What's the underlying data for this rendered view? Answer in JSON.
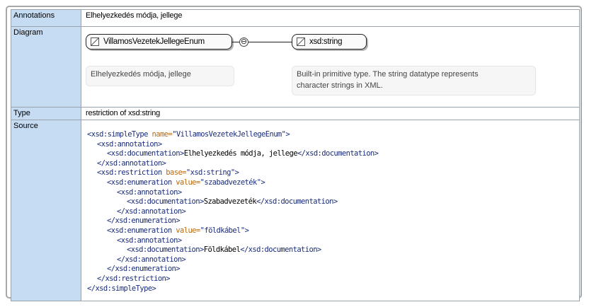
{
  "rows": {
    "annotations": {
      "label": "Annotations",
      "value": "Elhelyezkedés módja, jellege"
    },
    "diagram": {
      "label": "Diagram",
      "node_main": "VillamosVezetekJellegeEnum",
      "connector_symbol": "⊖",
      "node_base": "xsd:string",
      "doc_main": "Elhelyezkedés módja, jellege",
      "doc_base_line1": "Built-in primitive type. The string datatype represents",
      "doc_base_line2": "character strings in XML."
    },
    "type": {
      "label": "Type",
      "value": "restriction of xsd:string"
    },
    "source": {
      "label": "Source"
    }
  },
  "source_lines": [
    {
      "indent": 0,
      "parts": [
        [
          "t",
          "<xsd:simpleType "
        ],
        [
          "an",
          "name="
        ],
        [
          "av",
          "\"VillamosVezetekJellegeEnum\""
        ],
        [
          "t",
          ">"
        ]
      ]
    },
    {
      "indent": 1,
      "parts": [
        [
          "t",
          "<xsd:annotation>"
        ]
      ]
    },
    {
      "indent": 2,
      "parts": [
        [
          "t",
          "<xsd:documentation>"
        ],
        [
          "tx",
          "Elhelyezkedés módja, jellege"
        ],
        [
          "t",
          "</xsd:documentation>"
        ]
      ]
    },
    {
      "indent": 1,
      "parts": [
        [
          "t",
          "</xsd:annotation>"
        ]
      ]
    },
    {
      "indent": 1,
      "parts": [
        [
          "t",
          "<xsd:restriction "
        ],
        [
          "an",
          "base="
        ],
        [
          "av",
          "\"xsd:string\""
        ],
        [
          "t",
          ">"
        ]
      ]
    },
    {
      "indent": 2,
      "parts": [
        [
          "t",
          "<xsd:enumeration "
        ],
        [
          "an",
          "value="
        ],
        [
          "av",
          "\"szabadvezeték\""
        ],
        [
          "t",
          ">"
        ]
      ]
    },
    {
      "indent": 3,
      "parts": [
        [
          "t",
          "<xsd:annotation>"
        ]
      ]
    },
    {
      "indent": 4,
      "parts": [
        [
          "t",
          "<xsd:documentation>"
        ],
        [
          "tx",
          "Szabadvezeték"
        ],
        [
          "t",
          "</xsd:documentation>"
        ]
      ]
    },
    {
      "indent": 3,
      "parts": [
        [
          "t",
          "</xsd:annotation>"
        ]
      ]
    },
    {
      "indent": 2,
      "parts": [
        [
          "t",
          "</xsd:enumeration>"
        ]
      ]
    },
    {
      "indent": 2,
      "parts": [
        [
          "t",
          "<xsd:enumeration "
        ],
        [
          "an",
          "value="
        ],
        [
          "av",
          "\"földkábel\""
        ],
        [
          "t",
          ">"
        ]
      ]
    },
    {
      "indent": 3,
      "parts": [
        [
          "t",
          "<xsd:annotation>"
        ]
      ]
    },
    {
      "indent": 4,
      "parts": [
        [
          "t",
          "<xsd:documentation>"
        ],
        [
          "tx",
          "Földkábel"
        ],
        [
          "t",
          "</xsd:documentation>"
        ]
      ]
    },
    {
      "indent": 3,
      "parts": [
        [
          "t",
          "</xsd:annotation>"
        ]
      ]
    },
    {
      "indent": 2,
      "parts": [
        [
          "t",
          "</xsd:enumeration>"
        ]
      ]
    },
    {
      "indent": 1,
      "parts": [
        [
          "t",
          "</xsd:restriction>"
        ]
      ]
    },
    {
      "indent": 0,
      "parts": [
        [
          "t",
          "</xsd:simpleType>"
        ]
      ]
    }
  ],
  "colors": {
    "label_bg": "#c6dcf2",
    "border": "#9aa3ad",
    "tag": "#1a2c7a",
    "attr_name": "#b86a10"
  },
  "icons": {
    "node_icon": "simple-type-icon",
    "connector": "restriction-connector-icon"
  }
}
